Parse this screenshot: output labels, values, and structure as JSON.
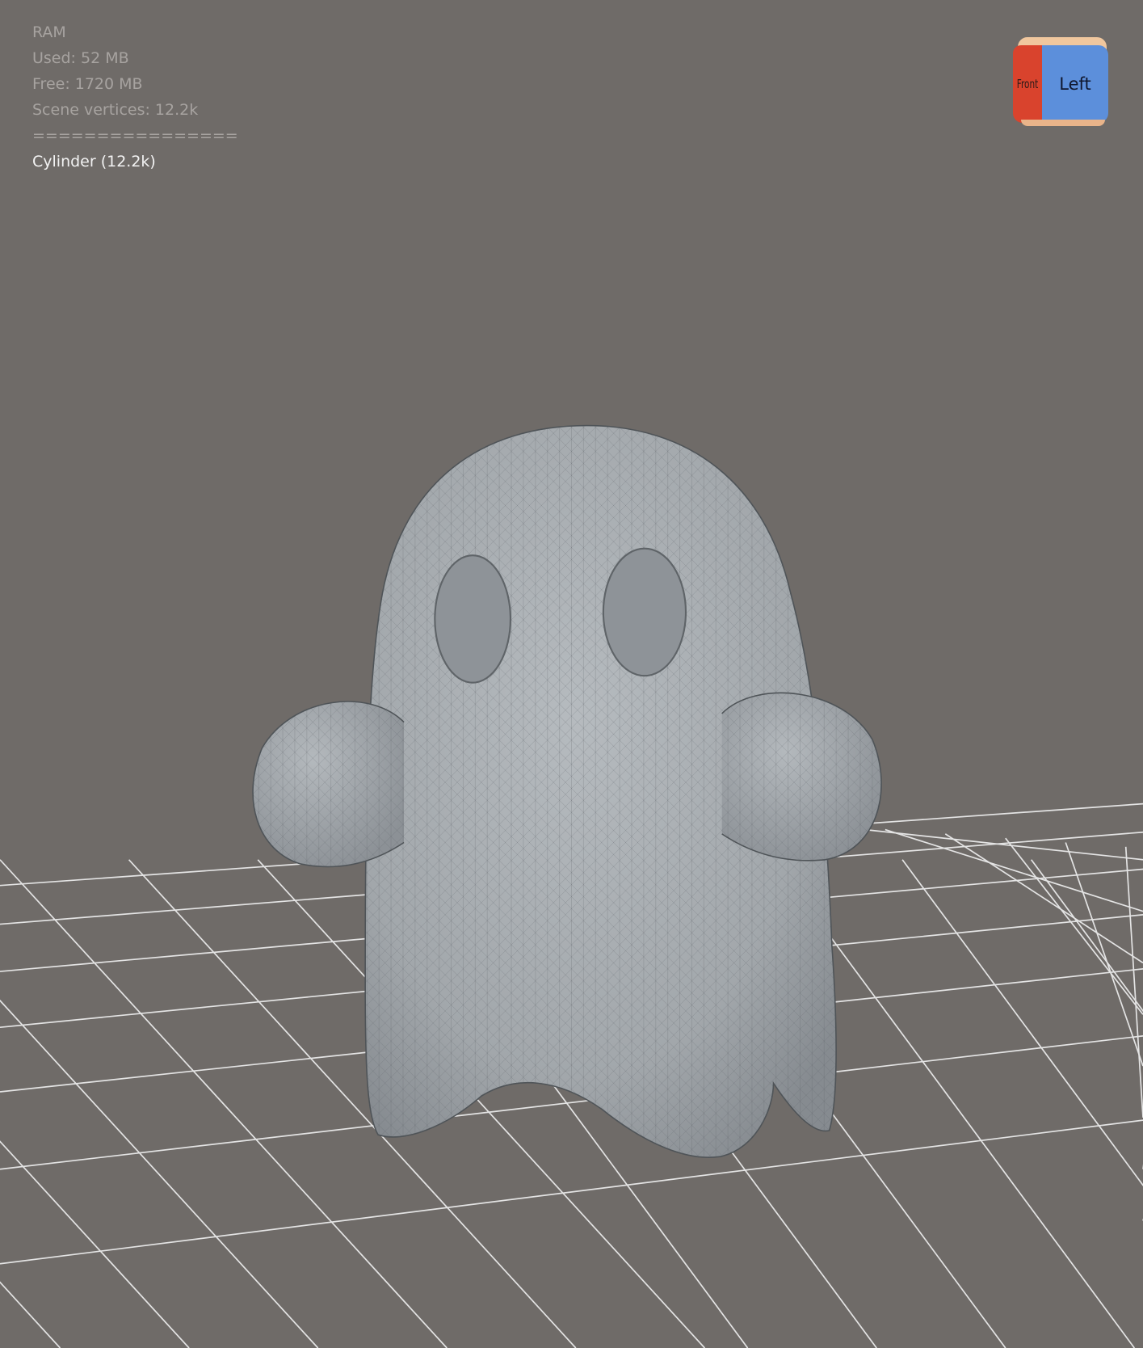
{
  "stats": {
    "title": "RAM",
    "used": "Used: 52 MB",
    "free": "Free: 1720 MB",
    "vertices": "Scene vertices: 12.2k",
    "separator": "================",
    "selected_object": "Cylinder (12.2k)"
  },
  "view_cube": {
    "front_label": "Front",
    "left_label": "Left"
  },
  "colors": {
    "background": "#6f6b68",
    "mesh": "#a9aeb2",
    "grid": "#e6e6e6"
  }
}
